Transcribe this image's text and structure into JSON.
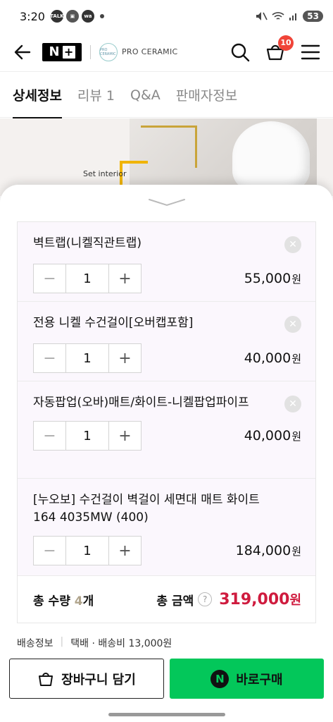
{
  "status_bar": {
    "time": "3:20",
    "icons": [
      "talk-icon",
      "scan-icon",
      "wa-icon"
    ],
    "battery": "53"
  },
  "header": {
    "logo_text": "N",
    "logo_plus": "+",
    "brand_logo_text": "PRO CERAMIC",
    "brand_name": "PRO CERAMIC",
    "cart_count": "10"
  },
  "tabs": [
    {
      "label": "상세정보",
      "active": true
    },
    {
      "label": "리뷰 1",
      "active": false
    },
    {
      "label": "Q&A",
      "active": false
    },
    {
      "label": "판매자정보",
      "active": false
    }
  ],
  "background": {
    "set_interior": "Set interior"
  },
  "options": [
    {
      "name": "벽트랩(니켈직관트랩)",
      "qty": "1",
      "price": "55,000",
      "unit": "원"
    },
    {
      "name": "전용 니켈 수건걸이[오버캡포함]",
      "qty": "1",
      "price": "40,000",
      "unit": "원"
    },
    {
      "name": "자동팝업(오바)매트/화이트-니켈팝업파이프",
      "qty": "1",
      "price": "40,000",
      "unit": "원"
    },
    {
      "name": "[누오보] 수건걸이 벽걸이 세면대 매트 화이트 164 4035MW (400)",
      "qty": "1",
      "price": "184,000",
      "unit": "원"
    }
  ],
  "stepper": {
    "minus": "−",
    "plus": "+"
  },
  "summary": {
    "qty_label": "총 수량 ",
    "qty_value": "4",
    "qty_unit": "개",
    "total_label": "총 금액",
    "help": "?",
    "total_value": "319,000",
    "total_unit": "원"
  },
  "shipping": {
    "label": "배송정보",
    "method": "택배 · 배송비 13,000원"
  },
  "buttons": {
    "cart": "장바구니 담기",
    "buy": "바로구매",
    "buy_logo": "N"
  },
  "colors": {
    "accent_green": "#03c75a",
    "price_red": "#cf1b3e",
    "badge_red": "#f04438"
  }
}
